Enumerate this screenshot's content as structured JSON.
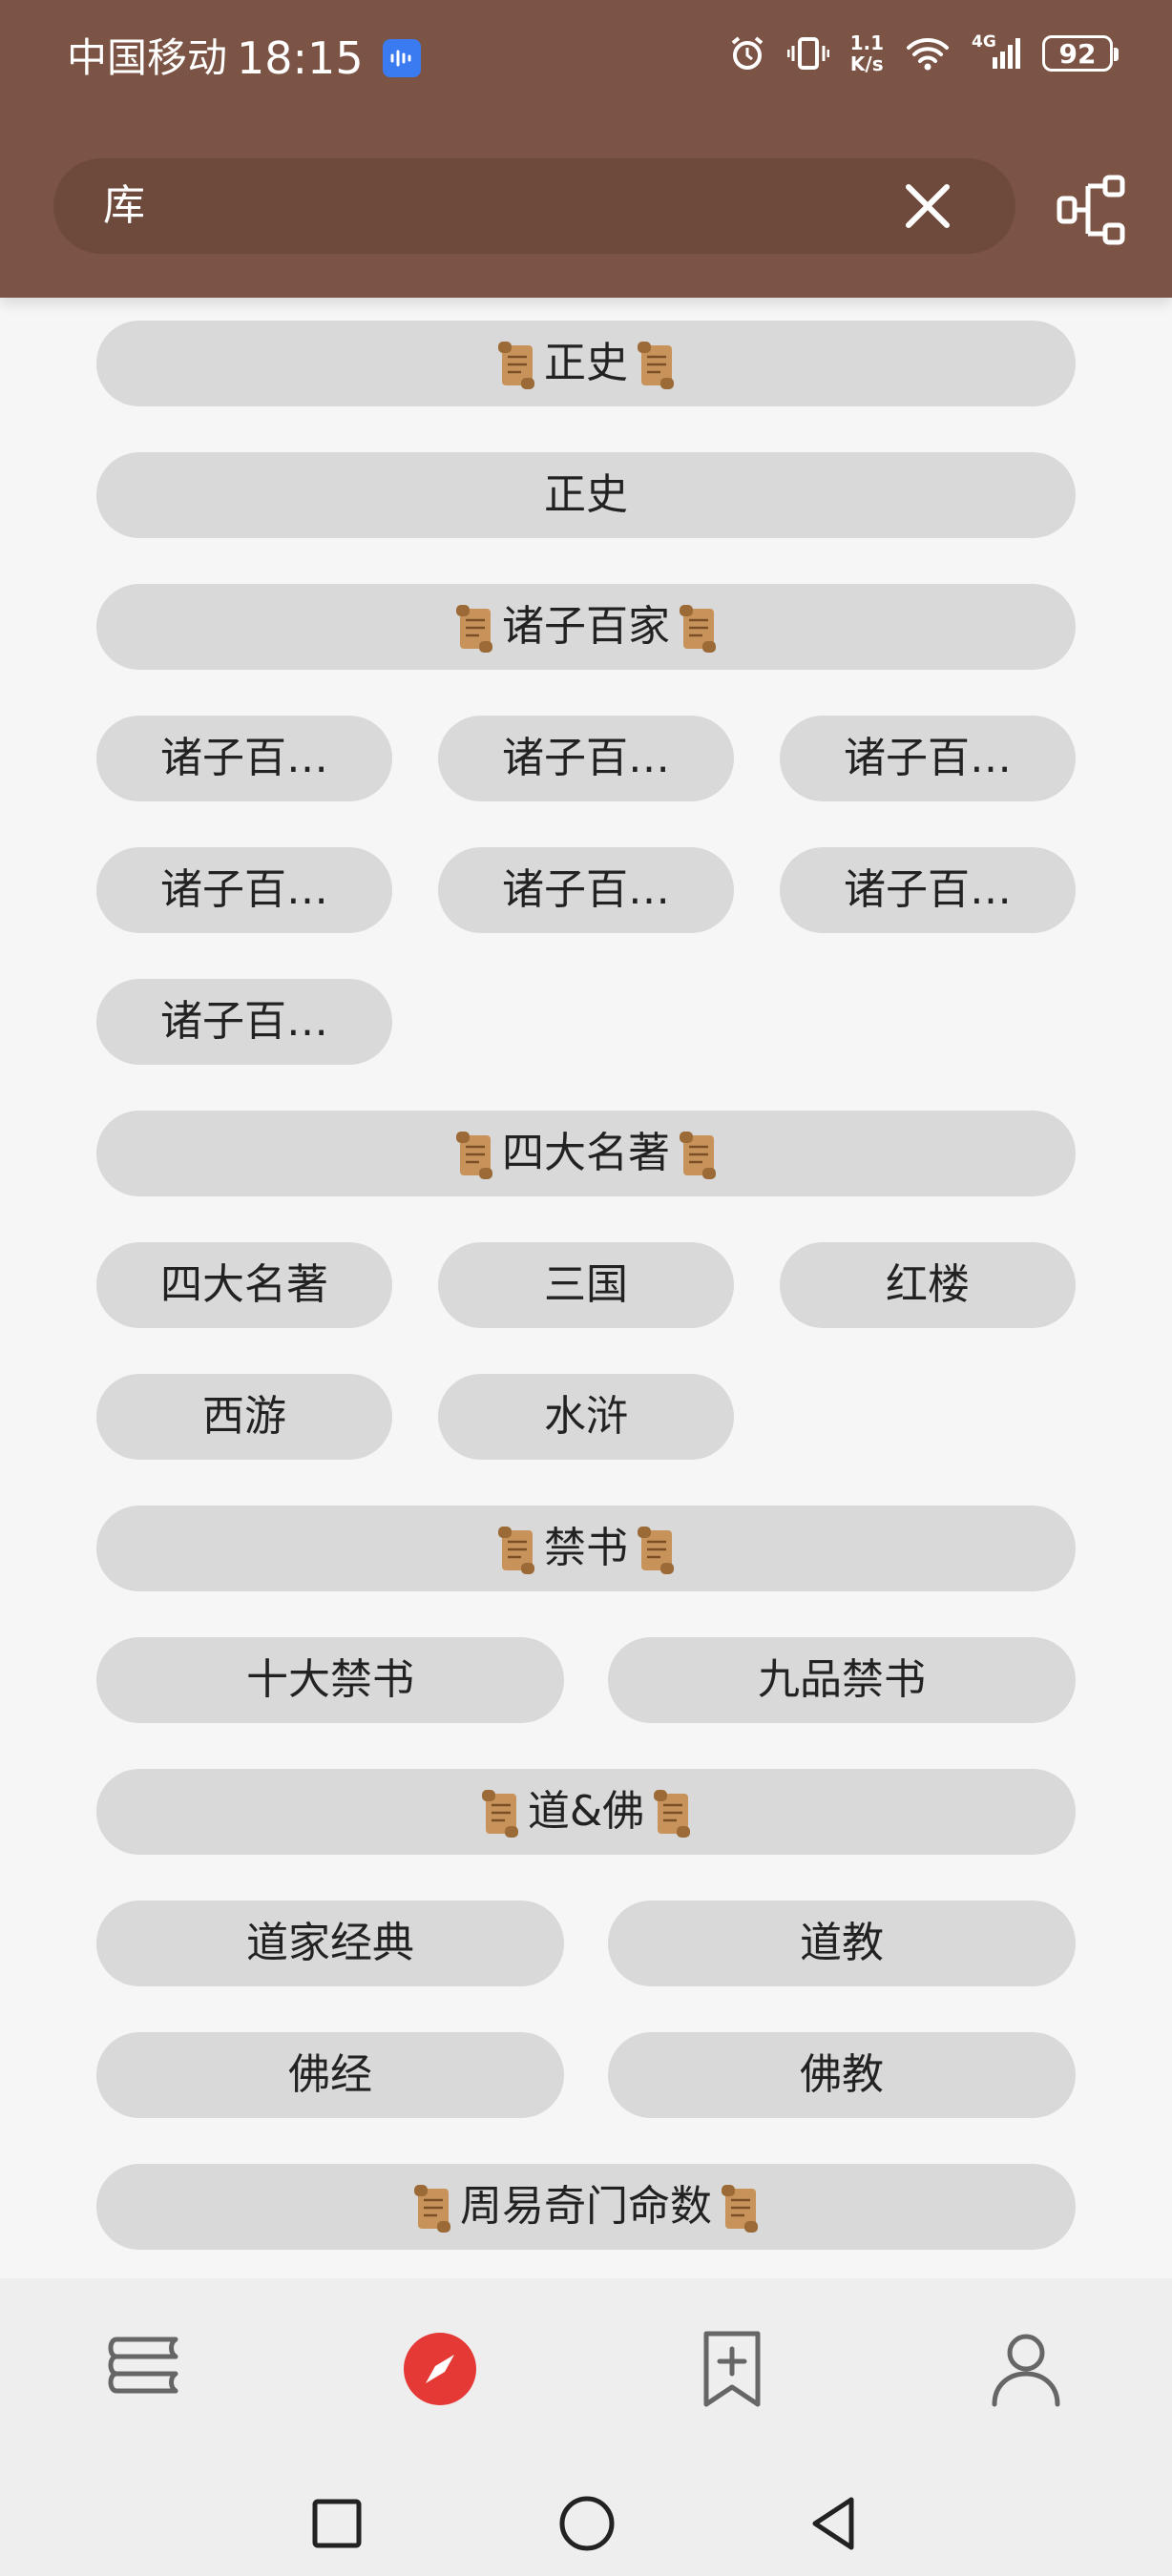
{
  "status_bar": {
    "carrier": "中国移动",
    "time": "18:15",
    "speed_top": "1.1",
    "speed_bottom": "K/s",
    "network": "4G",
    "battery": "92"
  },
  "search": {
    "value": "库"
  },
  "sections": [
    {
      "title": "正史",
      "items": [
        "正史"
      ]
    },
    {
      "title": "诸子百家",
      "items": [
        "诸子百…",
        "诸子百…",
        "诸子百…",
        "诸子百…",
        "诸子百…",
        "诸子百…",
        "诸子百…"
      ]
    },
    {
      "title": "四大名著",
      "items": [
        "四大名著",
        "三国",
        "红楼",
        "西游",
        "水浒"
      ]
    },
    {
      "title": "禁书",
      "items": [
        "十大禁书",
        "九品禁书"
      ]
    },
    {
      "title": "道&佛",
      "items": [
        "道家经典",
        "道教",
        "佛经",
        "佛教"
      ]
    },
    {
      "title": "周易奇门命数",
      "items": []
    }
  ],
  "icons": {
    "section_decoration": "scroll-icon",
    "clear": "close-icon",
    "tree": "tree-structure-icon",
    "nav": [
      "bookshelf-icon",
      "compass-icon",
      "bookmark-add-icon",
      "profile-icon"
    ],
    "system": [
      "square-icon",
      "circle-icon",
      "back-triangle-icon"
    ]
  },
  "colors": {
    "header": "#7b5445",
    "chip": "#d9d9d9",
    "accent": "#e53935"
  }
}
